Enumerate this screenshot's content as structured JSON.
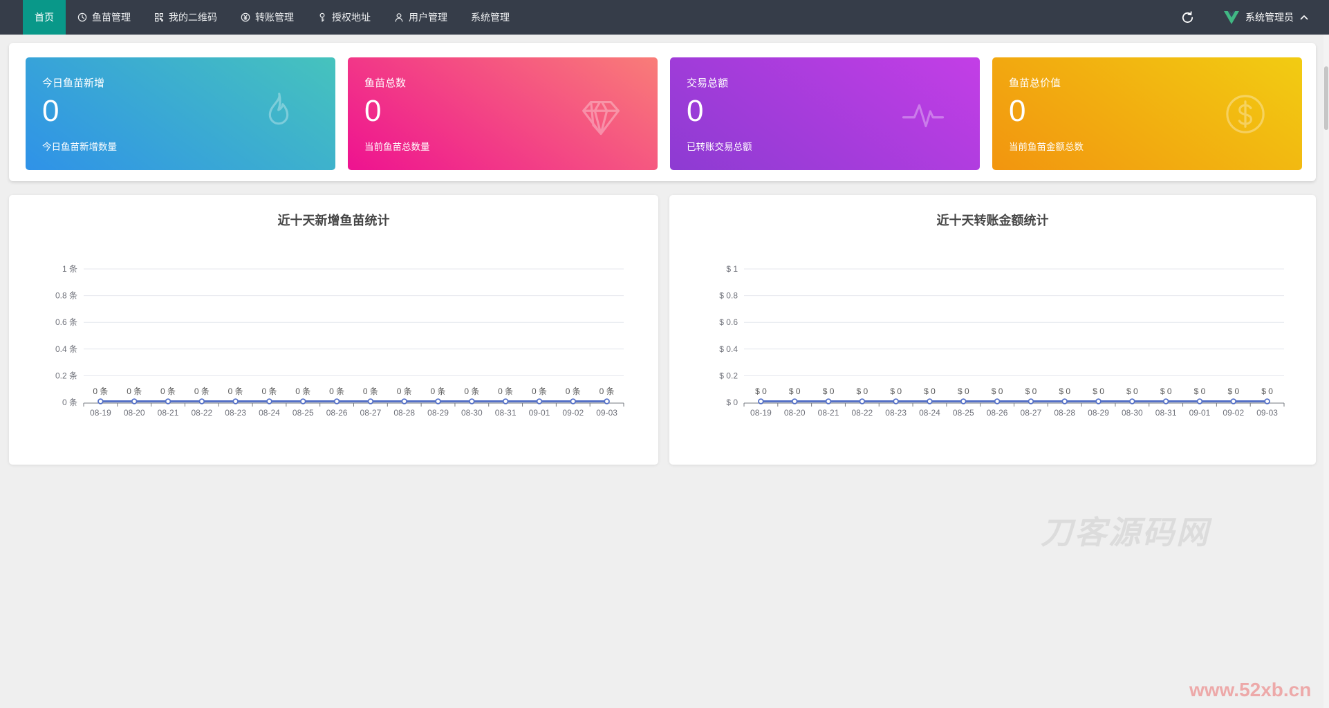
{
  "navbar": {
    "items": [
      {
        "key": "home",
        "label": "首页",
        "icon": null,
        "active": true
      },
      {
        "key": "fry-manage",
        "label": "鱼苗管理",
        "icon": "clock",
        "active": false
      },
      {
        "key": "my-qrcode",
        "label": "我的二维码",
        "icon": "qrcode",
        "active": false
      },
      {
        "key": "transfer-manage",
        "label": "转账管理",
        "icon": "yen-circle",
        "active": false
      },
      {
        "key": "auth-address",
        "label": "授权地址",
        "icon": "key",
        "active": false
      },
      {
        "key": "user-manage",
        "label": "用户管理",
        "icon": "user",
        "active": false
      },
      {
        "key": "system-manage",
        "label": "系统管理",
        "icon": null,
        "active": false
      }
    ],
    "user_name": "系统管理员"
  },
  "stat_cards": [
    {
      "key": "today-new",
      "title": "今日鱼苗新增",
      "value": "0",
      "subtitle": "今日鱼苗新增数量",
      "icon": "flame",
      "gradient": [
        "#46c3bd",
        "#2f92e8"
      ]
    },
    {
      "key": "fry-total",
      "title": "鱼苗总数",
      "value": "0",
      "subtitle": "当前鱼苗总数量",
      "icon": "gem",
      "gradient": [
        "#f97d78",
        "#ee1290"
      ]
    },
    {
      "key": "transaction-total",
      "title": "交易总额",
      "value": "0",
      "subtitle": "已转账交易总额",
      "icon": "pulse",
      "gradient": [
        "#c33ee6",
        "#8d3bd2"
      ]
    },
    {
      "key": "fry-value",
      "title": "鱼苗总价值",
      "value": "0",
      "subtitle": "当前鱼苗金额总数",
      "icon": "dollar-circle",
      "gradient": [
        "#f2cc12",
        "#f2950f"
      ]
    }
  ],
  "chart_data": [
    {
      "type": "line",
      "title": "近十天新增鱼苗统计",
      "x": [
        "08-19",
        "08-20",
        "08-21",
        "08-22",
        "08-23",
        "08-24",
        "08-25",
        "08-26",
        "08-27",
        "08-28",
        "08-29",
        "08-30",
        "08-31",
        "09-01",
        "09-02",
        "09-03"
      ],
      "series": [
        {
          "values": [
            0,
            0,
            0,
            0,
            0,
            0,
            0,
            0,
            0,
            0,
            0,
            0,
            0,
            0,
            0,
            0
          ]
        }
      ],
      "y_tick_labels": [
        "1 条",
        "0.8 条",
        "0.6 条",
        "0.4 条",
        "0.2 条",
        "0 条"
      ],
      "point_label_prefix": "",
      "point_label_suffix": " 条",
      "ylim": [
        0,
        1
      ],
      "grid": true,
      "legend": false,
      "line_color": "#5470c6"
    },
    {
      "type": "line",
      "title": "近十天转账金额统计",
      "x": [
        "08-19",
        "08-20",
        "08-21",
        "08-22",
        "08-23",
        "08-24",
        "08-25",
        "08-26",
        "08-27",
        "08-28",
        "08-29",
        "08-30",
        "08-31",
        "09-01",
        "09-02",
        "09-03"
      ],
      "series": [
        {
          "values": [
            0,
            0,
            0,
            0,
            0,
            0,
            0,
            0,
            0,
            0,
            0,
            0,
            0,
            0,
            0,
            0
          ]
        }
      ],
      "y_tick_labels": [
        "$ 1",
        "$ 0.8",
        "$ 0.6",
        "$ 0.4",
        "$ 0.2",
        "$ 0"
      ],
      "point_label_prefix": "$ ",
      "point_label_suffix": "",
      "ylim": [
        0,
        1
      ],
      "grid": true,
      "legend": false,
      "line_color": "#5470c6"
    }
  ],
  "watermark_text": "刀客源码网",
  "corner_watermark": "www.52xb.cn",
  "colors": {
    "navbar_bg": "#363d49",
    "active_tab": "#099889",
    "page_bg": "#efefef",
    "line_blue": "#5470c6",
    "vue_green": "#41b883",
    "vue_dark": "#34495e"
  }
}
